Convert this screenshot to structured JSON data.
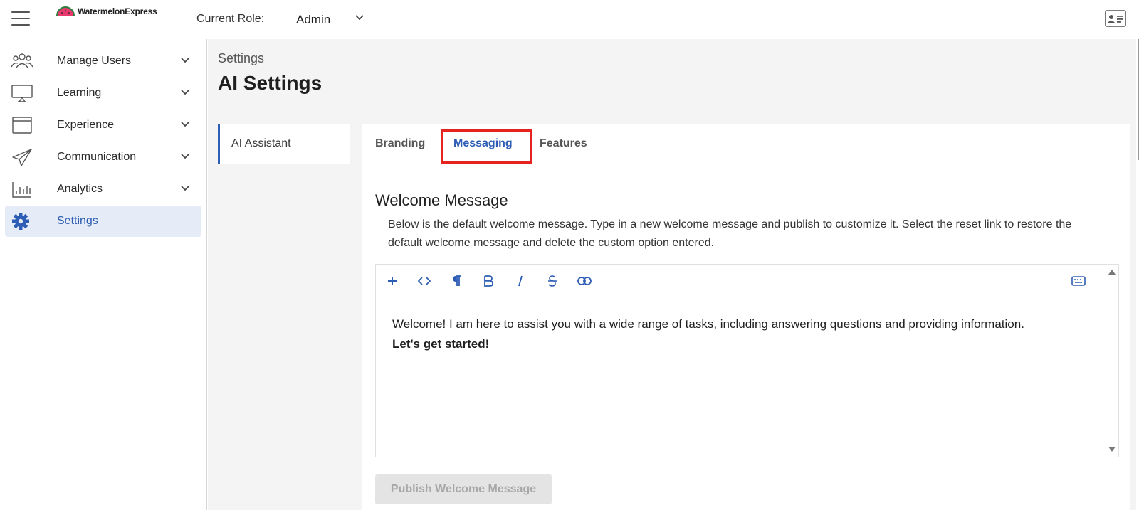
{
  "header": {
    "brand": "WatermelonExpress",
    "role_label": "Current Role:",
    "role_value": "Admin"
  },
  "sidebar": {
    "items": [
      {
        "label": "Manage Users",
        "icon": "users-icon"
      },
      {
        "label": "Learning",
        "icon": "monitor-icon"
      },
      {
        "label": "Experience",
        "icon": "browser-window-icon"
      },
      {
        "label": "Communication",
        "icon": "paper-plane-icon"
      },
      {
        "label": "Analytics",
        "icon": "bar-chart-icon"
      },
      {
        "label": "Settings",
        "icon": "gear-icon",
        "active": true
      }
    ]
  },
  "main": {
    "breadcrumb": "Settings",
    "title": "AI Settings",
    "subnav": {
      "label": "AI Assistant"
    },
    "tabs": [
      {
        "label": "Branding"
      },
      {
        "label": "Messaging",
        "active": true
      },
      {
        "label": "Features"
      }
    ],
    "section": {
      "title": "Welcome Message",
      "description": "Below is the default welcome message. Type in a new welcome message and publish to customize it. Select the reset link to restore the default welcome message and delete the custom option entered."
    },
    "editor": {
      "toolbar": [
        "plus-icon",
        "code-icon",
        "paragraph-icon",
        "bold-icon",
        "italic-icon",
        "strikethrough-icon",
        "link-icon",
        "keyboard-icon"
      ],
      "body_line1": "Welcome! I am here to assist you with a wide range of tasks, including answering questions and providing information.",
      "body_line2": "Let's get started!"
    },
    "publish_label": "Publish Welcome Message"
  },
  "colors": {
    "accent": "#2d5db4",
    "highlight_box": "#e5231f",
    "active_nav_bg": "#e6ecf7",
    "page_bg": "#f4f4f4"
  }
}
